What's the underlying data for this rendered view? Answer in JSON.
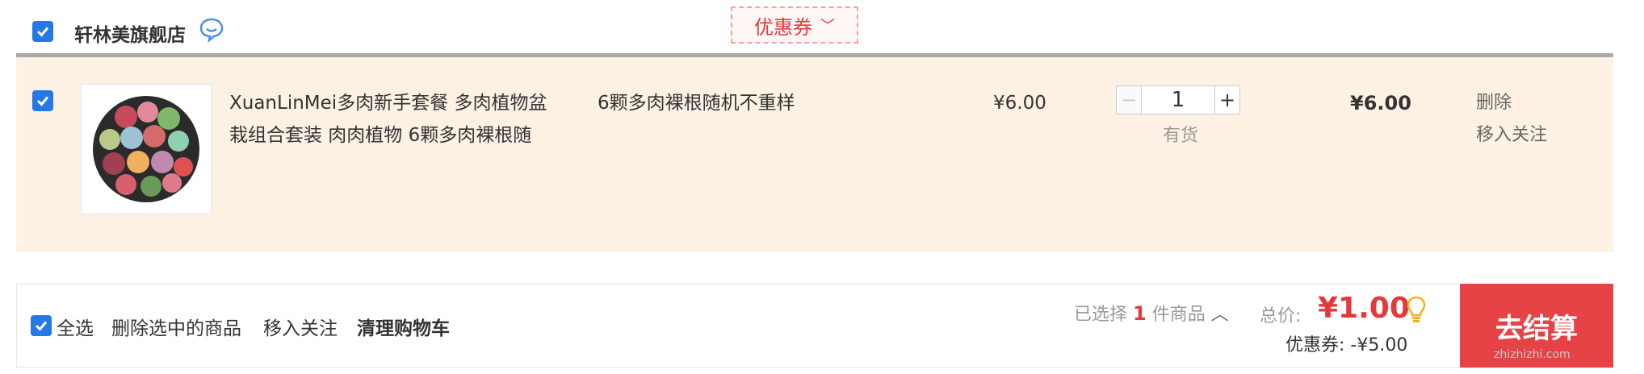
{
  "shop": {
    "name": "轩林美旗舰店",
    "coupon_label": "优惠券"
  },
  "item": {
    "title_line1": "XuanLinMei多肉新手套餐 多肉植物盆",
    "title_line2": "栽组合套装 肉肉植物 6颗多肉裸根随",
    "spec": "6颗多肉裸根随机不重样",
    "unit_price": "¥6.00",
    "quantity": "1",
    "stock_status": "有货",
    "subtotal": "¥6.00",
    "op_delete": "删除",
    "op_follow": "移入关注"
  },
  "footer": {
    "select_all": "全选",
    "delete_selected": "删除选中的商品",
    "move_to_follow": "移入关注",
    "clear_cart": "清理购物车",
    "selected_prefix": "已选择",
    "selected_count": "1",
    "selected_suffix": "件商品",
    "total_label": "总价:",
    "total_value": "¥1.00",
    "discount": "优惠券: -¥5.00",
    "checkout": "去结算",
    "watermark": "zhizhizhi.com"
  },
  "colors": {
    "accent": "#e4393c",
    "checkbox": "#2478e8",
    "item_bg": "#fdf1e4"
  }
}
